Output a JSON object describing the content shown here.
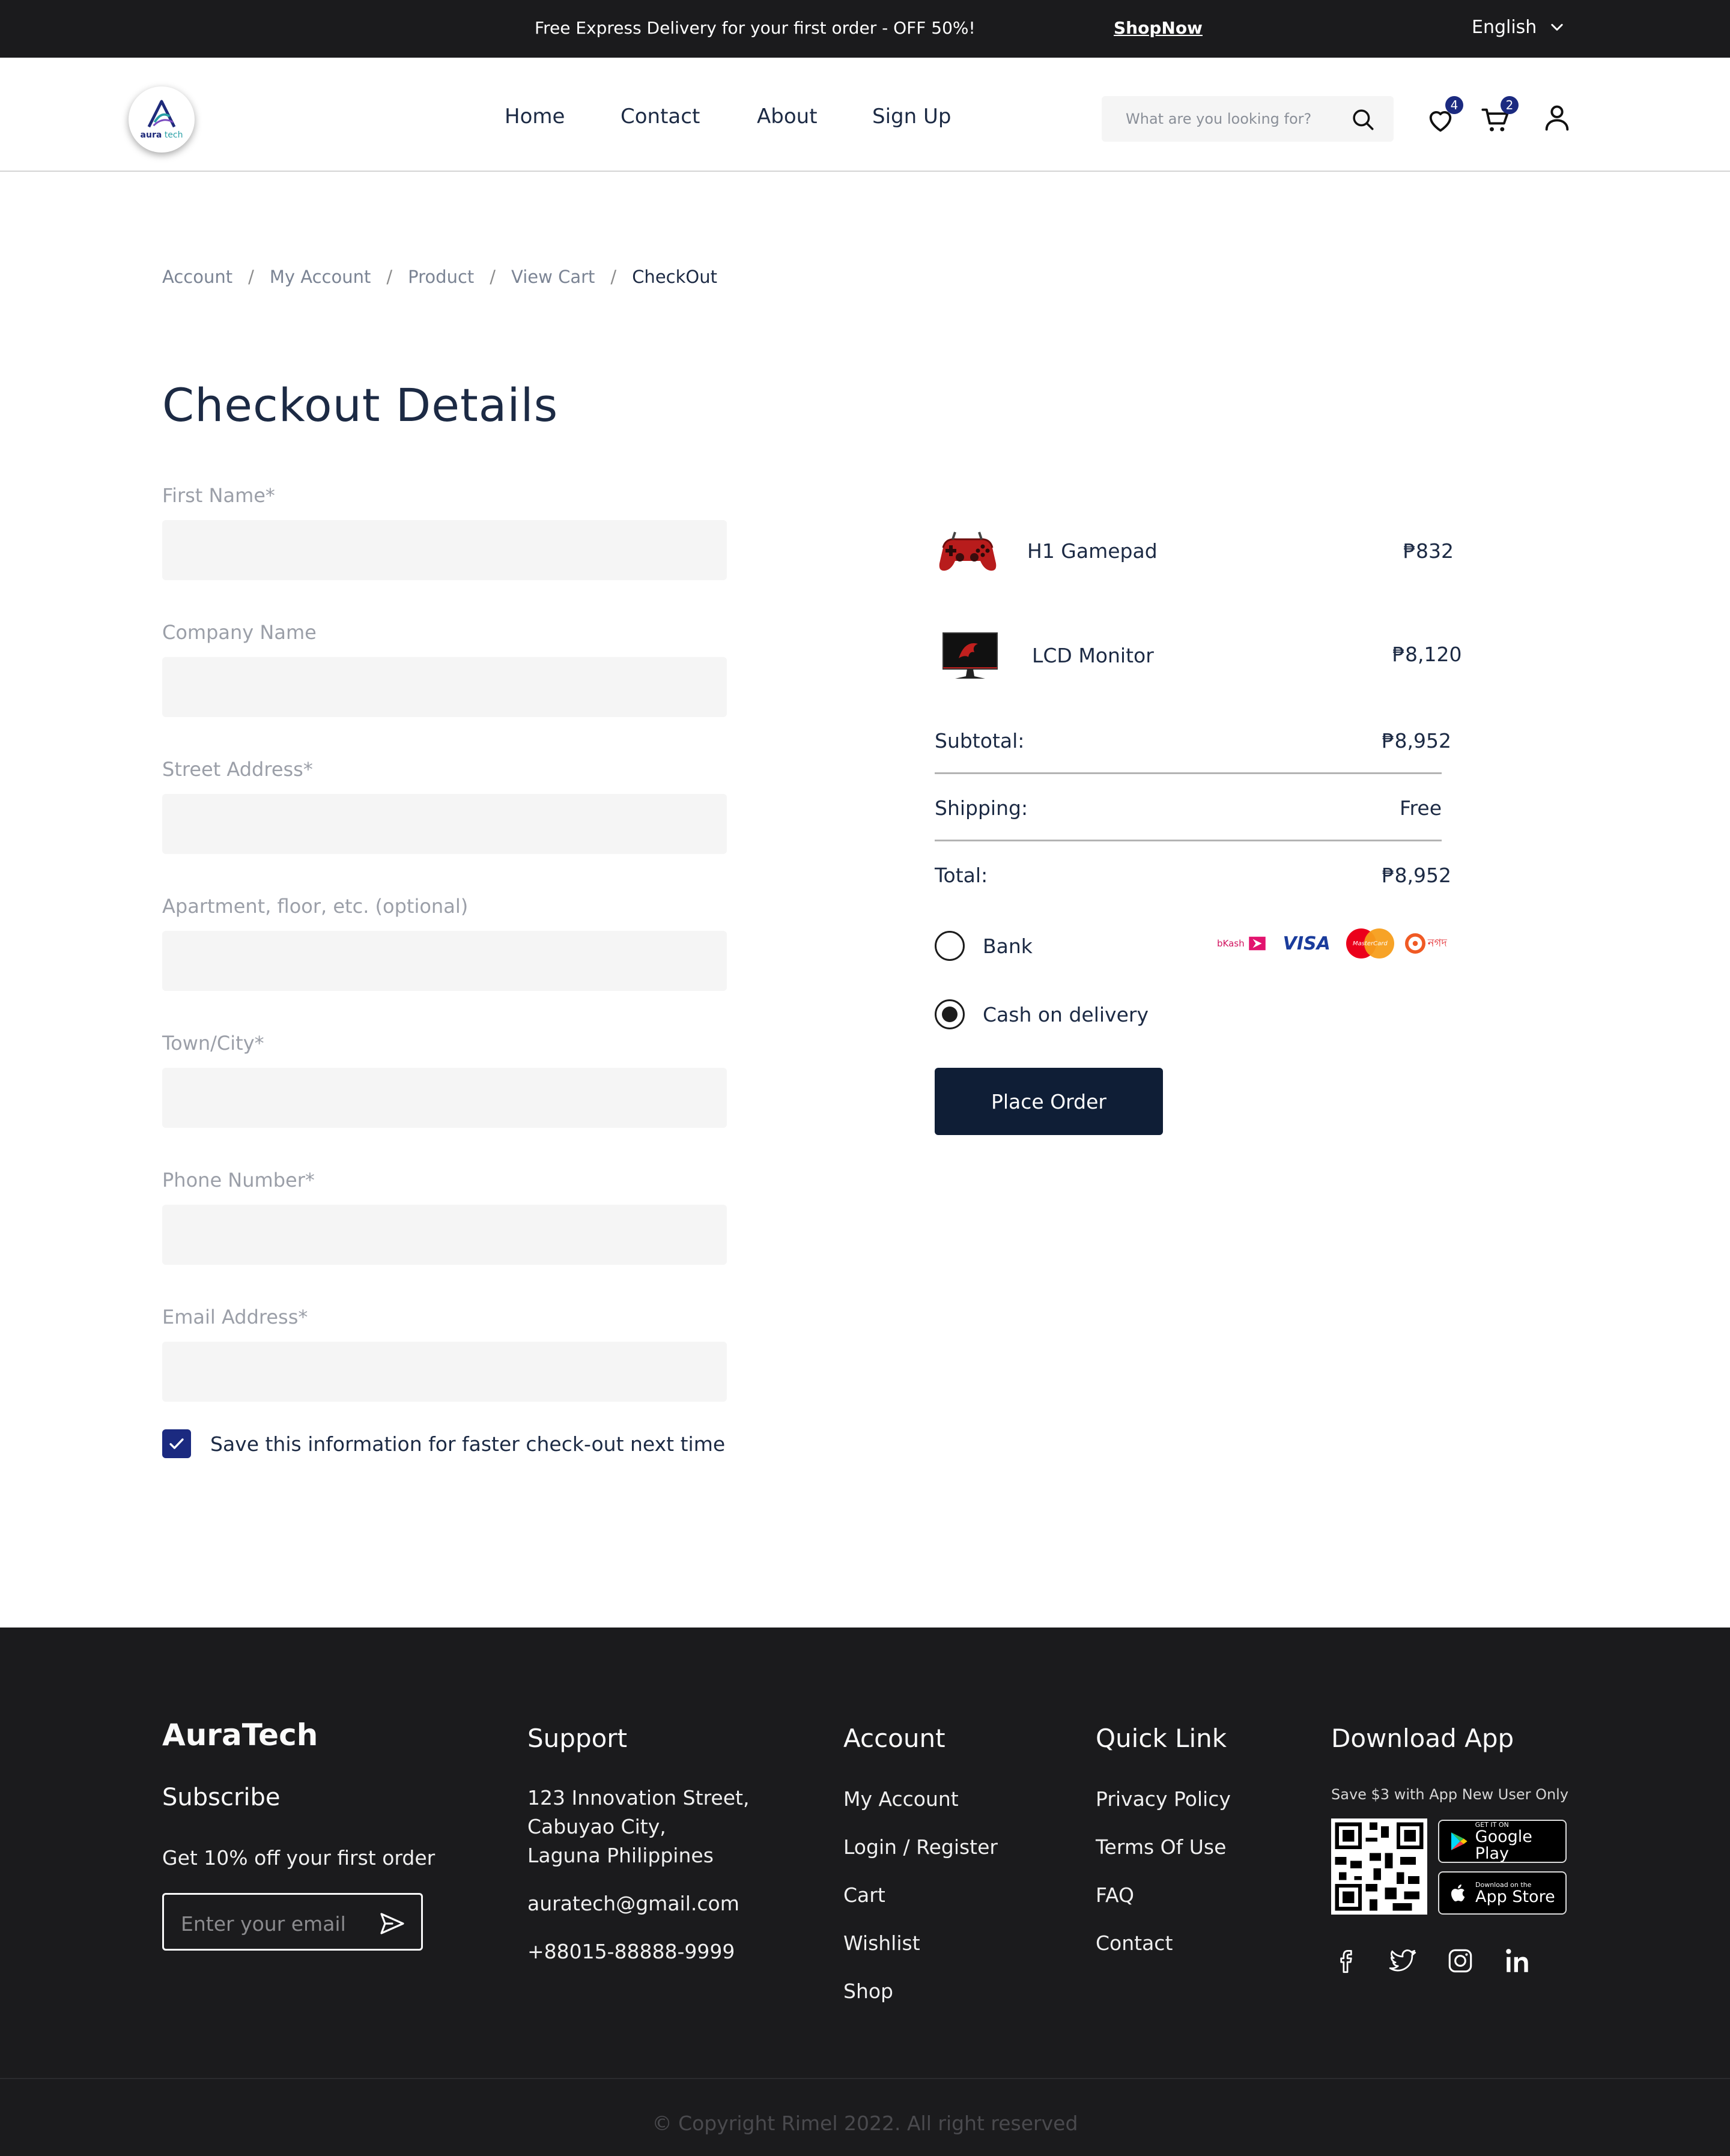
{
  "topbar": {
    "promo": "Free Express Delivery for your first order - OFF 50%!",
    "shop_now": "ShopNow",
    "language": "English"
  },
  "header": {
    "logo_word1": "aura",
    "logo_word2": "tech",
    "nav": [
      "Home",
      "Contact",
      "About",
      "Sign Up"
    ],
    "search_placeholder": "What are you looking for?",
    "wishlist_count": "4",
    "cart_count": "2"
  },
  "breadcrumb": [
    "Account",
    "My Account",
    "Product",
    "View Cart",
    "CheckOut"
  ],
  "page_title": "Checkout Details",
  "form": {
    "fields": [
      {
        "label": "First Name*",
        "value": ""
      },
      {
        "label": "Company Name",
        "value": ""
      },
      {
        "label": "Street Address*",
        "value": ""
      },
      {
        "label": "Apartment, floor, etc. (optional)",
        "value": ""
      },
      {
        "label": "Town/City*",
        "value": ""
      },
      {
        "label": "Phone Number*",
        "value": ""
      },
      {
        "label": "Email Address*",
        "value": ""
      }
    ],
    "save_info_label": "Save this information for faster check-out next time",
    "save_info_checked": true
  },
  "order": {
    "items": [
      {
        "name": "H1 Gamepad",
        "price": "₱832"
      },
      {
        "name": "LCD Monitor",
        "price": "₱8,120"
      }
    ],
    "subtotal_label": "Subtotal:",
    "subtotal_value": "₱8,952",
    "shipping_label": "Shipping:",
    "shipping_value": "Free",
    "total_label": "Total:",
    "total_value": "₱8,952",
    "payment": {
      "bank_label": "Bank",
      "cod_label": "Cash on delivery",
      "selected": "cod",
      "logos": [
        "bKash",
        "VISA",
        "MasterCard",
        "নগদ"
      ]
    },
    "place_order_label": "Place Order"
  },
  "footer": {
    "brand": "AuraTech",
    "subscribe_title": "Subscribe",
    "subscribe_text": "Get 10% off your first order",
    "email_placeholder": "Enter your email",
    "support_title": "Support",
    "support_lines": [
      "123 Innovation Street,",
      "Cabuyao City,",
      "Laguna Philippines",
      "auratech@gmail.com",
      "+88015-88888-9999"
    ],
    "account_title": "Account",
    "account_links": [
      "My Account",
      "Login / Register",
      "Cart",
      "Wishlist",
      "Shop"
    ],
    "quick_title": "Quick Link",
    "quick_links": [
      "Privacy Policy",
      "Terms Of Use",
      "FAQ",
      "Contact"
    ],
    "download_title": "Download App",
    "download_note": "Save $3 with App New User Only",
    "google_small": "GET IT ON",
    "google_big": "Google Play",
    "apple_small": "Download on the",
    "apple_big": "App Store",
    "copyright": "Copyright Rimel 2022. All right reserved"
  },
  "colors": {
    "dark": "#1b1b1d",
    "navy_button": "#0f1e36",
    "accent": "#1b2a80",
    "input_bg": "#f5f5f5"
  }
}
